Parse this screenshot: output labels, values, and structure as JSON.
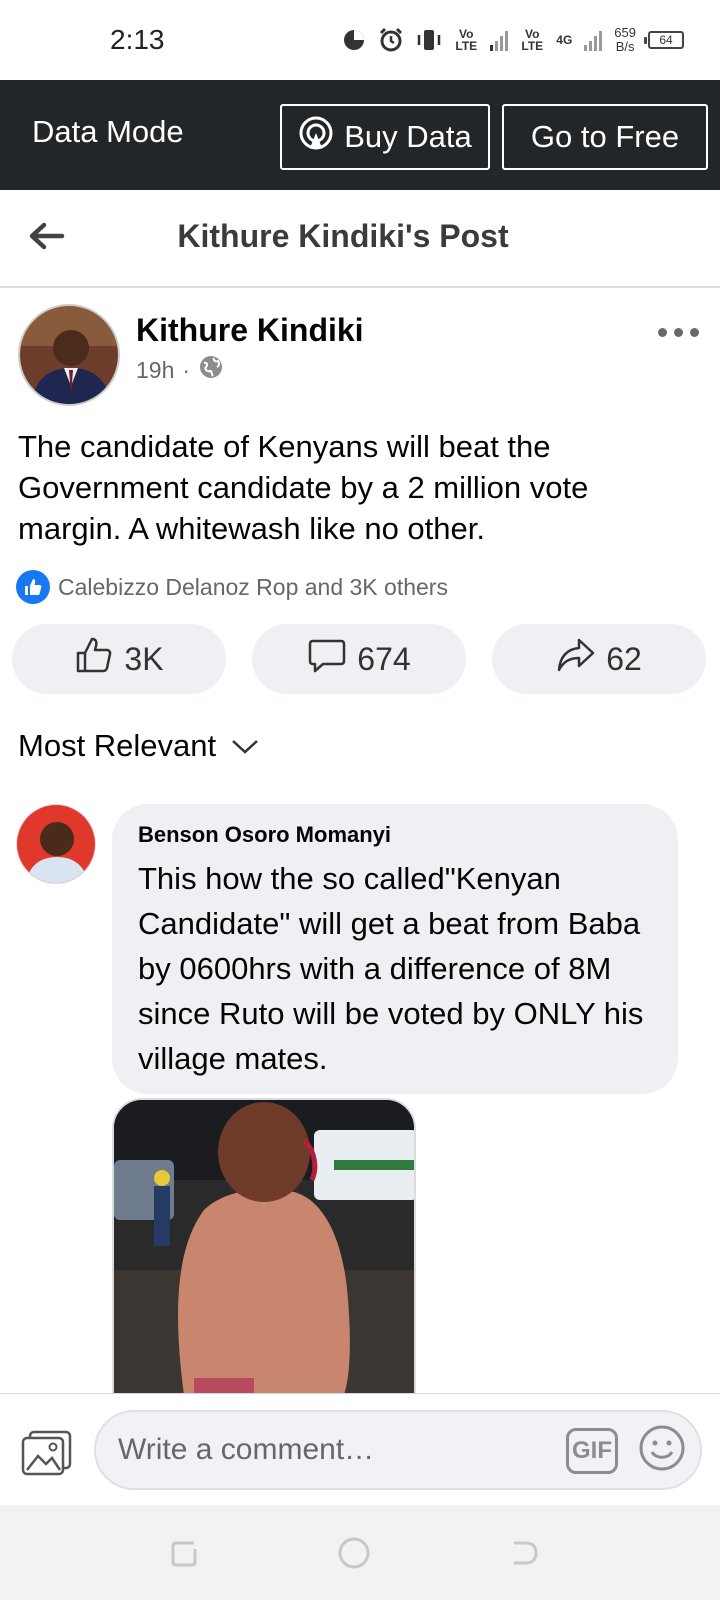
{
  "status_bar": {
    "time": "2:13",
    "sim1": "Vo LTE",
    "sim2": "Vo LTE",
    "network": "4G",
    "speed_value": "659",
    "speed_unit": "B/s",
    "battery": "64"
  },
  "data_mode": {
    "title": "Data Mode",
    "buy_label": "Buy Data",
    "free_label": "Go to Free"
  },
  "header": {
    "title": "Kithure Kindiki's Post"
  },
  "post": {
    "author": "Kithure Kindiki",
    "time": "19h",
    "text": "The candidate of Kenyans will beat the Government candidate by a 2 million vote margin. A whitewash like no other.",
    "reactions_text": "Calebizzo Delanoz Rop and 3K others",
    "likes": "3K",
    "comments": "674",
    "shares": "62"
  },
  "sort": {
    "label": "Most Relevant"
  },
  "comment": {
    "author": "Benson Osoro Momanyi",
    "text": "This how the so called\"Kenyan Candidate\" will get a beat from Baba by 0600hrs with a difference of 8M since Ruto will be voted by ONLY his village mates."
  },
  "composer": {
    "placeholder": "Write a comment…",
    "gif_label": "GIF"
  },
  "colors": {
    "data_bar_bg": "#222629",
    "like_blue": "#1877f2",
    "pill_bg": "#eff0f3"
  }
}
